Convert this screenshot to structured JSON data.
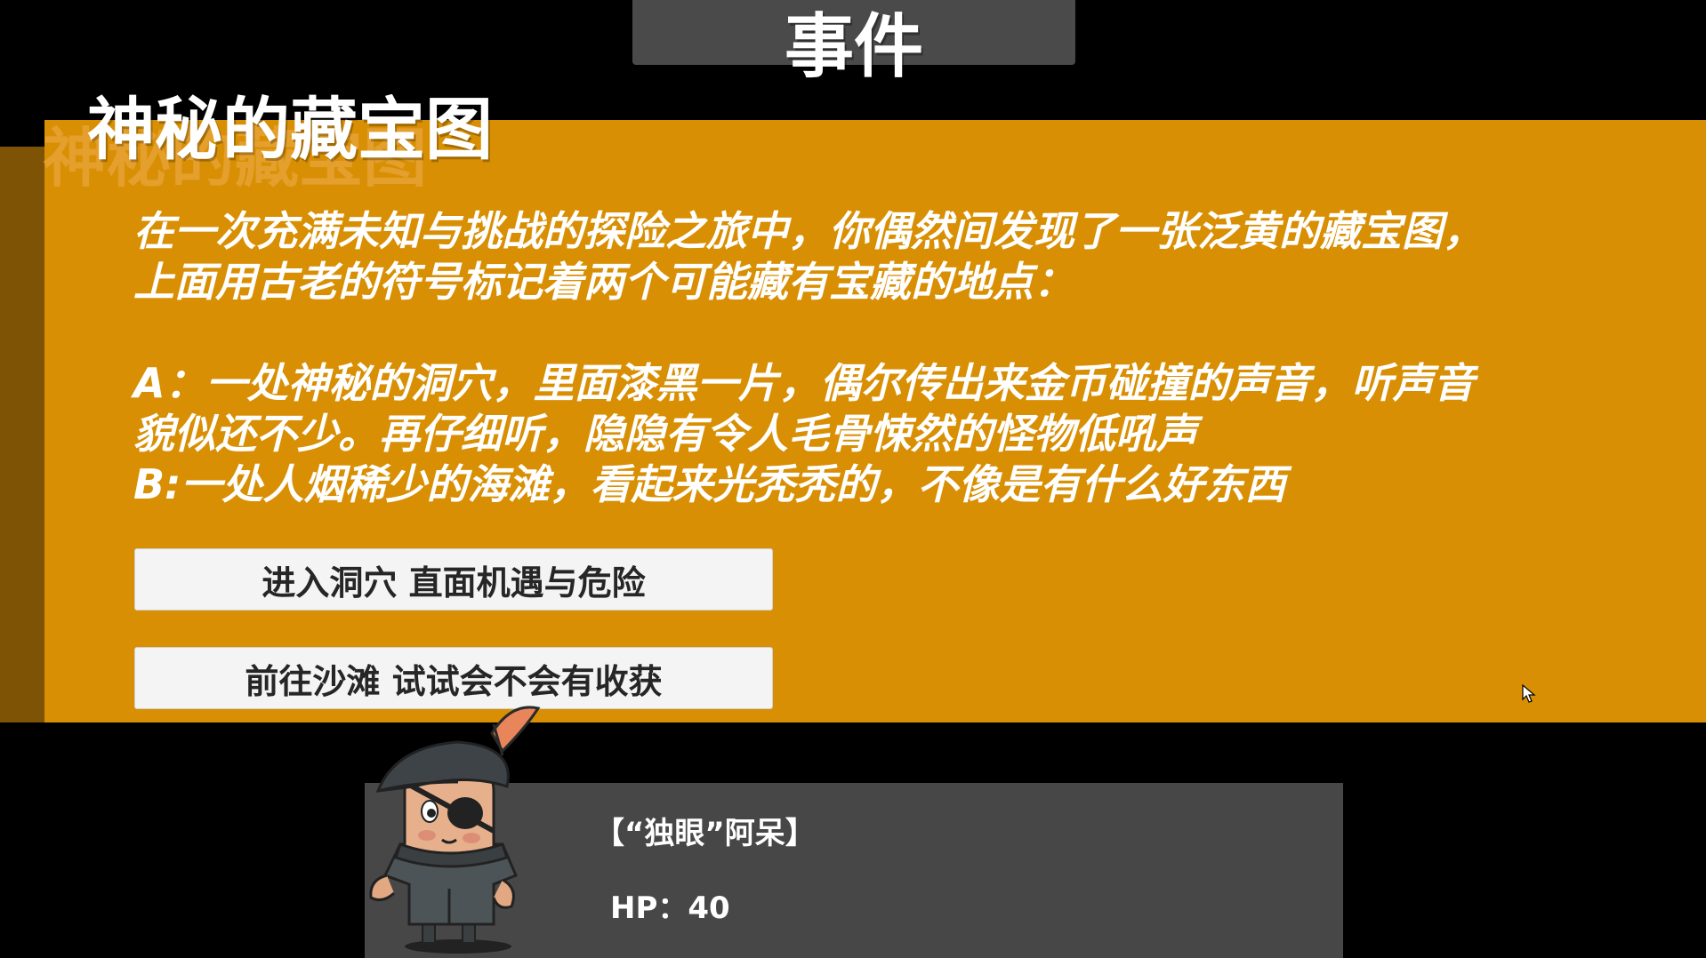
{
  "header": {
    "title": "事件"
  },
  "event": {
    "title": "神秘的藏宝图",
    "description_lines": [
      "在一次充满未知与挑战的探险之旅中，你偶然间发现了一张泛黄的藏宝图，",
      "上面用古老的符号标记着两个可能藏有宝藏的地点：",
      "",
      "A：一处神秘的洞穴，里面漆黑一片，偶尔传出来金币碰撞的声音，听声音",
      "貌似还不少。再仔细听，隐隐有令人毛骨悚然的怪物低吼声",
      "B:一处人烟稀少的海滩，看起来光秃秃的，不像是有什么好东西"
    ],
    "choices": [
      {
        "label": "进入洞穴 直面机遇与危险"
      },
      {
        "label": "前往沙滩 试试会不会有收获"
      }
    ]
  },
  "character": {
    "name": "【“独眼”阿呆】",
    "hp_label": "HP：40",
    "portrait_icon": "pirate-character-icon"
  },
  "colors": {
    "panel": "#d88f03",
    "panel_shadow": "#7f5306",
    "header_bg": "#4a4a4a",
    "char_panel_bg": "#474747",
    "button_bg": "#f4f4f4"
  }
}
